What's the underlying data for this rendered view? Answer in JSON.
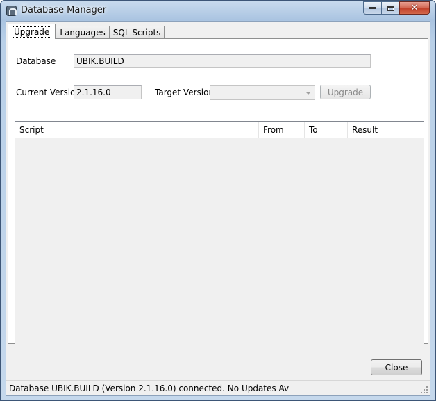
{
  "window": {
    "title": "Database Manager",
    "icon": "database-app-icon",
    "controls": [
      "minimize-icon",
      "maximize-icon",
      "close-icon"
    ]
  },
  "tabs": [
    {
      "label": "Upgrade",
      "active": true
    },
    {
      "label": "Languages",
      "active": false
    },
    {
      "label": "SQL Scripts",
      "active": false
    }
  ],
  "upgrade": {
    "database_label": "Database",
    "database_value": "UBIK.BUILD",
    "current_version_label": "Current Version",
    "current_version_value": "2.1.16.0",
    "target_version_label": "Target Version",
    "target_version_value": "",
    "upgrade_button": "Upgrade"
  },
  "script_list": {
    "columns": [
      "Script",
      "From",
      "To",
      "Result"
    ],
    "rows": []
  },
  "footer": {
    "close_button": "Close"
  },
  "statusbar": {
    "text": "Database UBIK.BUILD (Version 2.1.16.0) connected. No Updates Av"
  },
  "colors": {
    "title_bar": "#aac4e1",
    "close_button": "#c1412b",
    "client_background": "#f0f0f0",
    "panel_background": "#ffffff"
  }
}
